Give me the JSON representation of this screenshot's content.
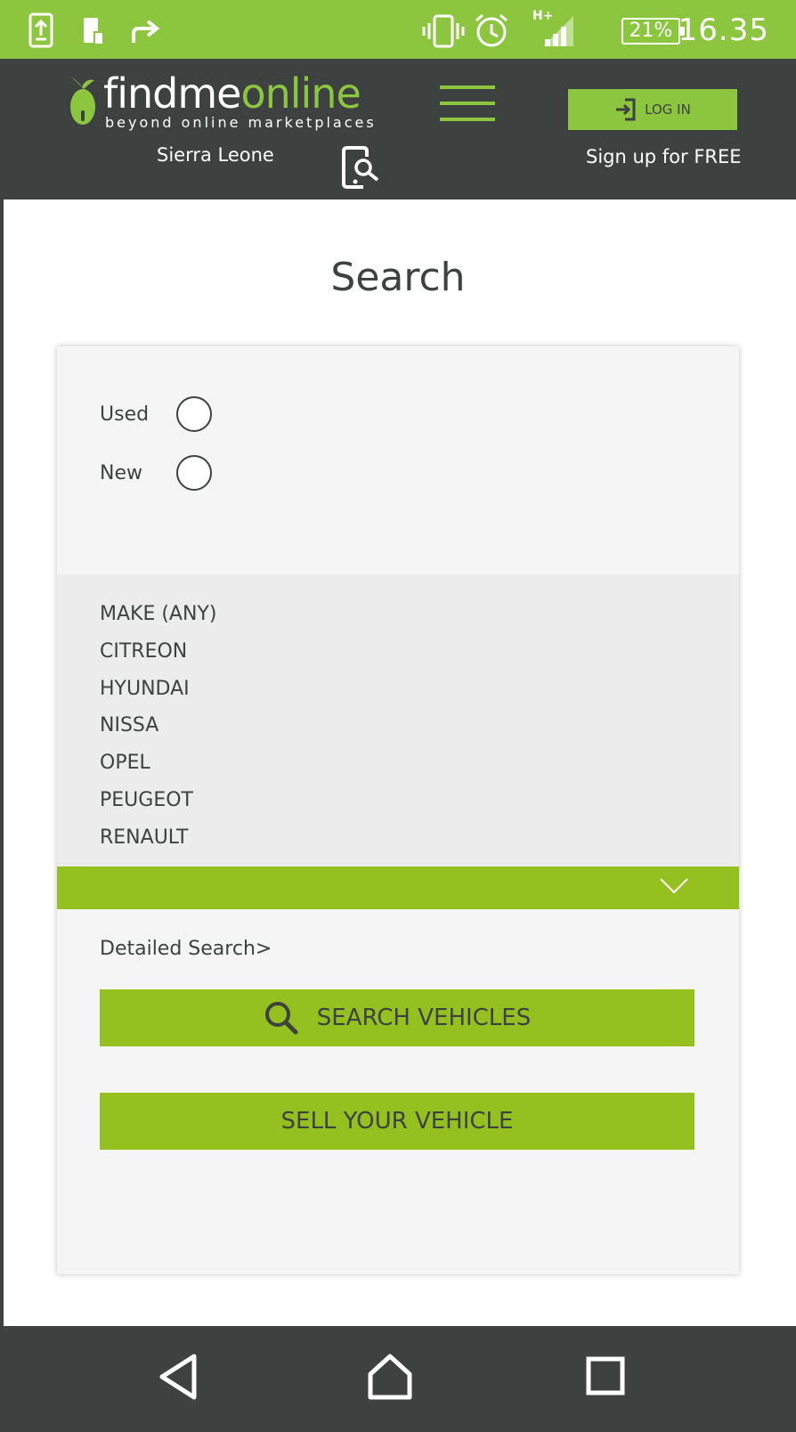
{
  "status_bar": {
    "time": "16.35",
    "battery": "21%",
    "network": "H+",
    "icons": [
      "screen-transfer-icon",
      "phone-download-icon",
      "share-arrow-icon",
      "vibrate-icon",
      "alarm-icon",
      "signal-icon",
      "battery-icon"
    ]
  },
  "header": {
    "logo_main": "findme",
    "logo_accent": "online",
    "tagline": "beyond online marketplaces",
    "login_label": "LOG IN",
    "country": "Sierra Leone",
    "signup_label": "Sign up for FREE"
  },
  "page": {
    "title": "Search"
  },
  "condition": {
    "options": [
      {
        "label": "Used"
      },
      {
        "label": "New"
      }
    ]
  },
  "make_list": {
    "items": [
      "MAKE (ANY)",
      "CITREON",
      "HYUNDAI",
      "NISSA",
      "OPEL",
      "PEUGEOT",
      "RENAULT"
    ]
  },
  "links": {
    "detailed_search": "Detailed Search>"
  },
  "buttons": {
    "search_vehicles": "SEARCH VEHICLES",
    "sell_vehicle": "SELL YOUR VEHICLE"
  },
  "colors": {
    "accent": "#8cc63f",
    "accent_dark": "#94c11f",
    "header_bg": "#3d4240",
    "card_bg": "#f5f5f5"
  }
}
